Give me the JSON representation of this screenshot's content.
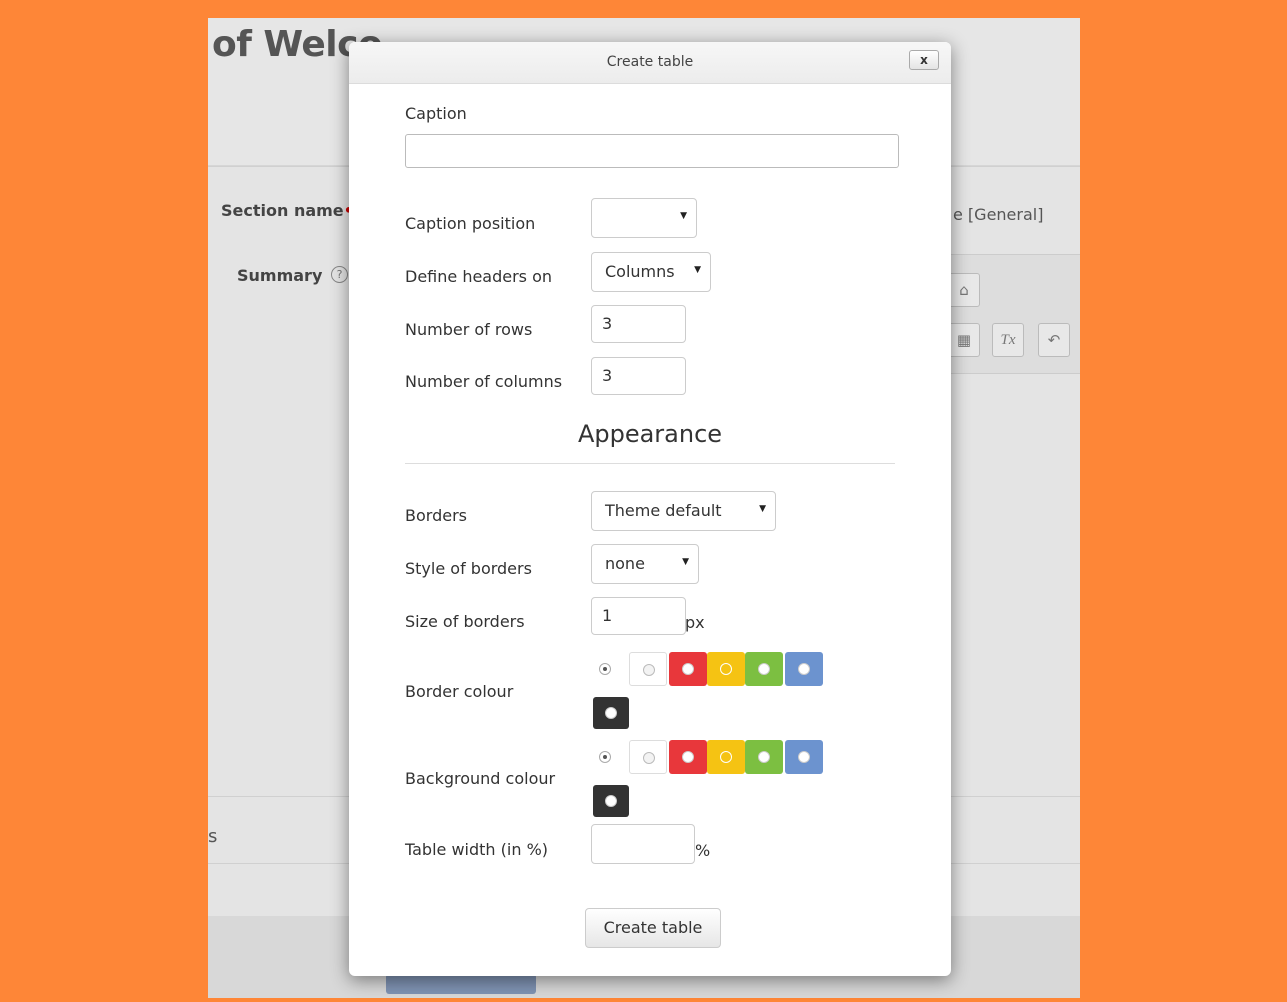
{
  "background": {
    "heading": "of Welco",
    "section_label": "Section name",
    "required_mark": "•",
    "summary_label": "Summary",
    "help_icon": "?",
    "general_text": "e [General]",
    "side_letter": "s",
    "toolbar_icons": [
      "home-icon",
      "table-icon",
      "clear-format-icon",
      "undo-icon"
    ],
    "toolbar_glyphs": [
      "⌂",
      "▦",
      "Tx",
      "↶"
    ]
  },
  "dialog": {
    "title": "Create table",
    "close_label": "x",
    "caption_label": "Caption",
    "caption_value": "",
    "caption_position_label": "Caption position",
    "caption_position_value": "",
    "define_headers_label": "Define headers on",
    "define_headers_value": "Columns",
    "rows_label": "Number of rows",
    "rows_value": "3",
    "columns_label": "Number of columns",
    "columns_value": "3",
    "appearance_heading": "Appearance",
    "borders_label": "Borders",
    "borders_value": "Theme default",
    "border_style_label": "Style of borders",
    "border_style_value": "none",
    "border_size_label": "Size of borders",
    "border_size_value": "1",
    "border_size_unit": "px",
    "border_colour_label": "Border colour",
    "background_colour_label": "Background colour",
    "table_width_label": "Table width (in %)",
    "table_width_value": "",
    "table_width_unit": "%",
    "submit_label": "Create table",
    "select_arrow": "▼"
  },
  "colours": {
    "swatches": [
      "#ffffff",
      "#e8373b",
      "#f5c313",
      "#7cbf41",
      "#6c93cf",
      "#333333"
    ],
    "accent_background": "#fe8637"
  }
}
